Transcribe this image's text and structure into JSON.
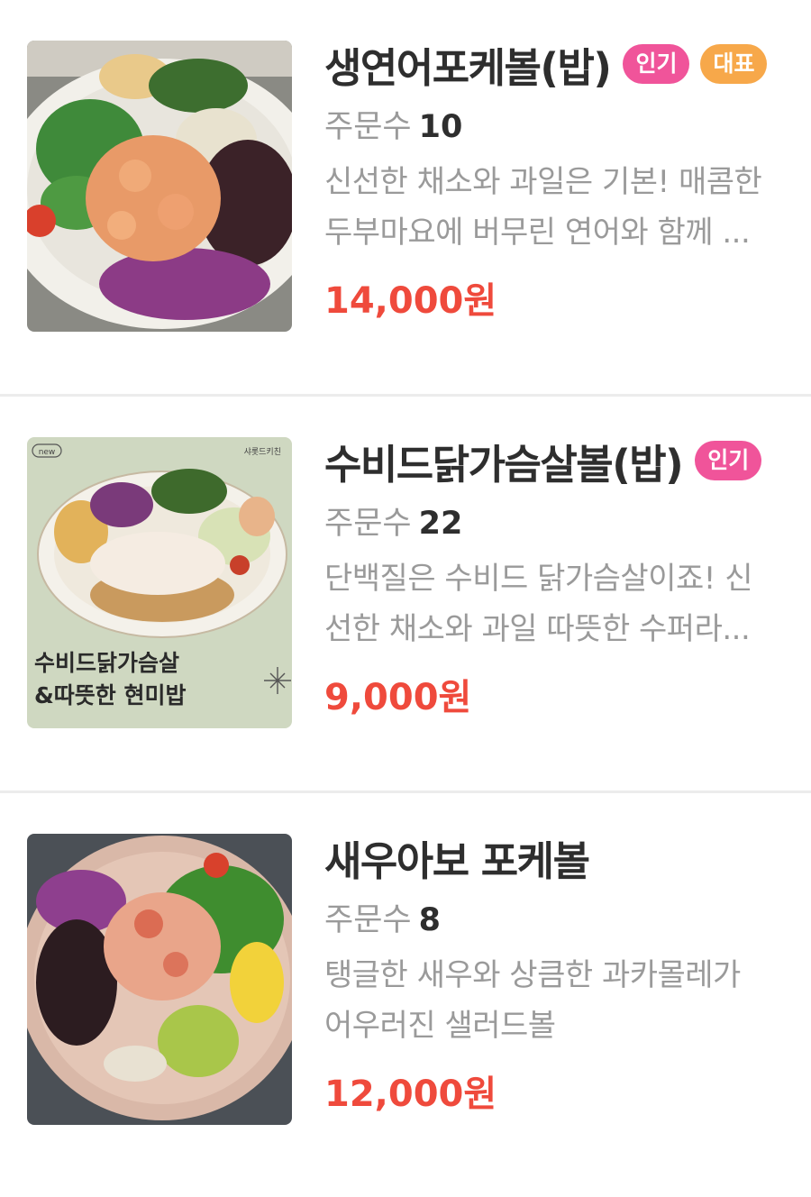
{
  "items": [
    {
      "name": "생연어포케볼(밥)",
      "badges": [
        "인기",
        "대표"
      ],
      "orders_label": "주문수",
      "orders": "10",
      "desc_line1": "신선한 채소와 과일은 기본! 매콤한",
      "desc_line2": "두부마요에 버무린 연어와 함께 ...",
      "price": "14,000원"
    },
    {
      "name": "수비드닭가슴살볼(밥)",
      "badges": [
        "인기"
      ],
      "orders_label": "주문수",
      "orders": "22",
      "desc_line1": "단백질은 수비드 닭가슴살이죠! 신",
      "desc_line2": "선한 채소와 과일 따뜻한 수퍼라...",
      "price": "9,000원",
      "image_text": {
        "tag": "new",
        "brand": "샤롯드키친",
        "line1": "수비드닭가슴살",
        "line2": "&따뜻한 현미밥"
      }
    },
    {
      "name": "새우아보 포케볼",
      "badges": [],
      "orders_label": "주문수",
      "orders": "8",
      "desc_line1": "탱글한 새우와 상큼한 과카몰레가",
      "desc_line2": "어우러진 샐러드볼",
      "price": "12,000원"
    }
  ],
  "colors": {
    "price": "#ef4a3c",
    "badge_popular": "#f0549a",
    "badge_representative": "#f7a84a"
  }
}
